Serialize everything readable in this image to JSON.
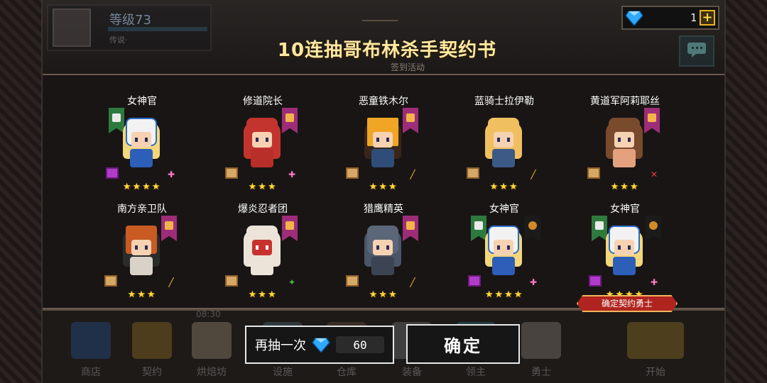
{
  "hud": {
    "level": "等级73",
    "player_sub": "传说·",
    "gems": "1"
  },
  "title": "10连抽哥布林杀手契约书",
  "sign_event": "签到活动",
  "heroes": [
    {
      "name": "女神官",
      "stars": "★★★★"
    },
    {
      "name": "修道院长",
      "stars": "★★★"
    },
    {
      "name": "恶童铁木尔",
      "stars": "★★★"
    },
    {
      "name": "蓝骑士拉伊勒",
      "stars": "★★★"
    },
    {
      "name": "黄道军阿莉耶丝",
      "stars": "★★★"
    },
    {
      "name": "南方亲卫队",
      "stars": "★★★"
    },
    {
      "name": "爆炎忍者团",
      "stars": "★★★"
    },
    {
      "name": "猎鹰精英",
      "stars": "★★★"
    },
    {
      "name": "女神官",
      "stars": "★★★★"
    },
    {
      "name": "女神官",
      "stars": "★★★★"
    }
  ],
  "confirm_tag": "确定契约勇士",
  "dock": [
    {
      "label": "商店"
    },
    {
      "label": "契约"
    },
    {
      "label": "烘焙坊"
    },
    {
      "label": "设施"
    },
    {
      "label": "仓库"
    },
    {
      "label": "装备"
    },
    {
      "label": "领主"
    },
    {
      "label": "勇士"
    },
    {
      "label": "开始"
    }
  ],
  "dock_timer": "08:30",
  "buttons": {
    "again_label": "再抽一次",
    "again_cost": "60",
    "ok_label": "确定"
  },
  "colors": {
    "accent_gold": "#ffd93b",
    "tag_red": "#b0241f",
    "gem_blue": "#2fa9ff"
  }
}
